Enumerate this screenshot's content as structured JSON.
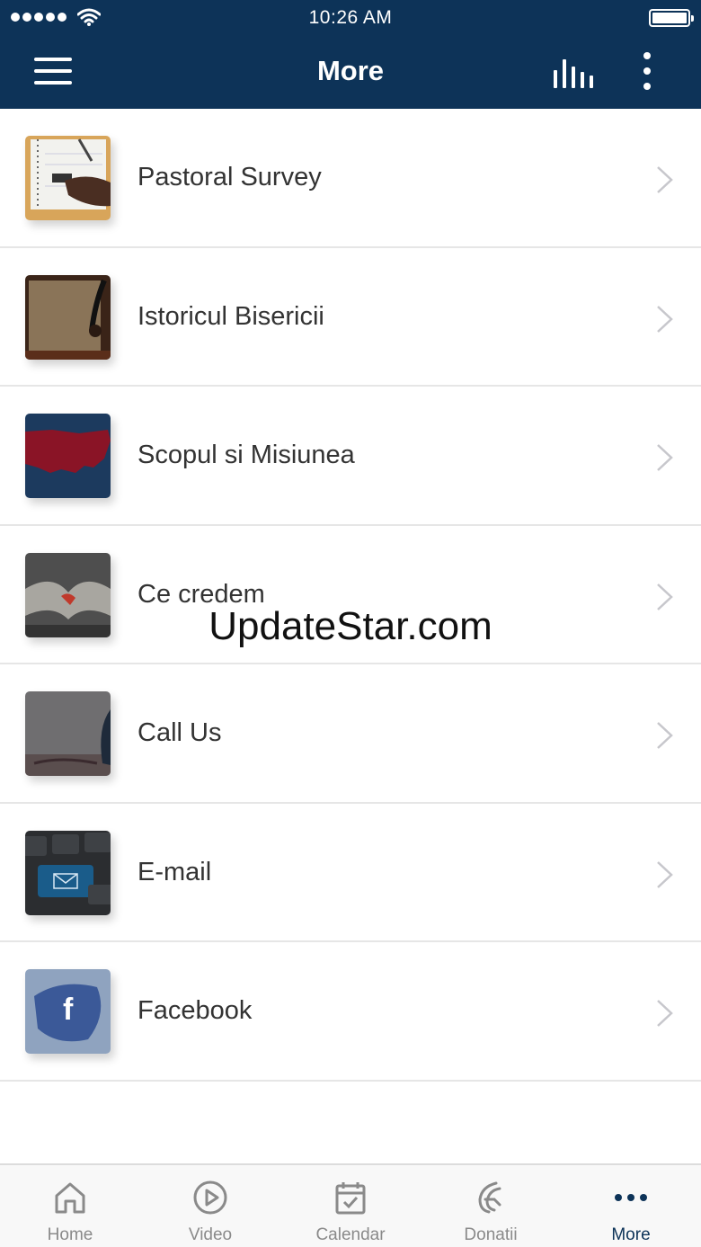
{
  "status_bar": {
    "time": "10:26 AM"
  },
  "header": {
    "title": "More"
  },
  "items": [
    {
      "label": "Pastoral Survey",
      "icon": "notebook-writing-thumb"
    },
    {
      "label": "Istoricul Bisericii",
      "icon": "quill-parchment-thumb"
    },
    {
      "label": "Scopul si Misiunea",
      "icon": "map-thumb"
    },
    {
      "label": "Ce credem",
      "icon": "open-bible-thumb"
    },
    {
      "label": "Call Us",
      "icon": "telephone-thumb"
    },
    {
      "label": "E-mail",
      "icon": "email-key-thumb"
    },
    {
      "label": "Facebook",
      "icon": "facebook-thumb"
    }
  ],
  "watermark": "UpdateStar.com",
  "tabs": [
    {
      "label": "Home",
      "icon": "home-icon"
    },
    {
      "label": "Video",
      "icon": "play-icon"
    },
    {
      "label": "Calendar",
      "icon": "calendar-icon"
    },
    {
      "label": "Donatii",
      "icon": "donate-icon"
    },
    {
      "label": "More",
      "icon": "more-dots-icon",
      "active": true
    }
  ],
  "colors": {
    "header_bg": "#0d3358",
    "active_tab": "#0d3358",
    "inactive_tab": "#8a8a8a"
  }
}
